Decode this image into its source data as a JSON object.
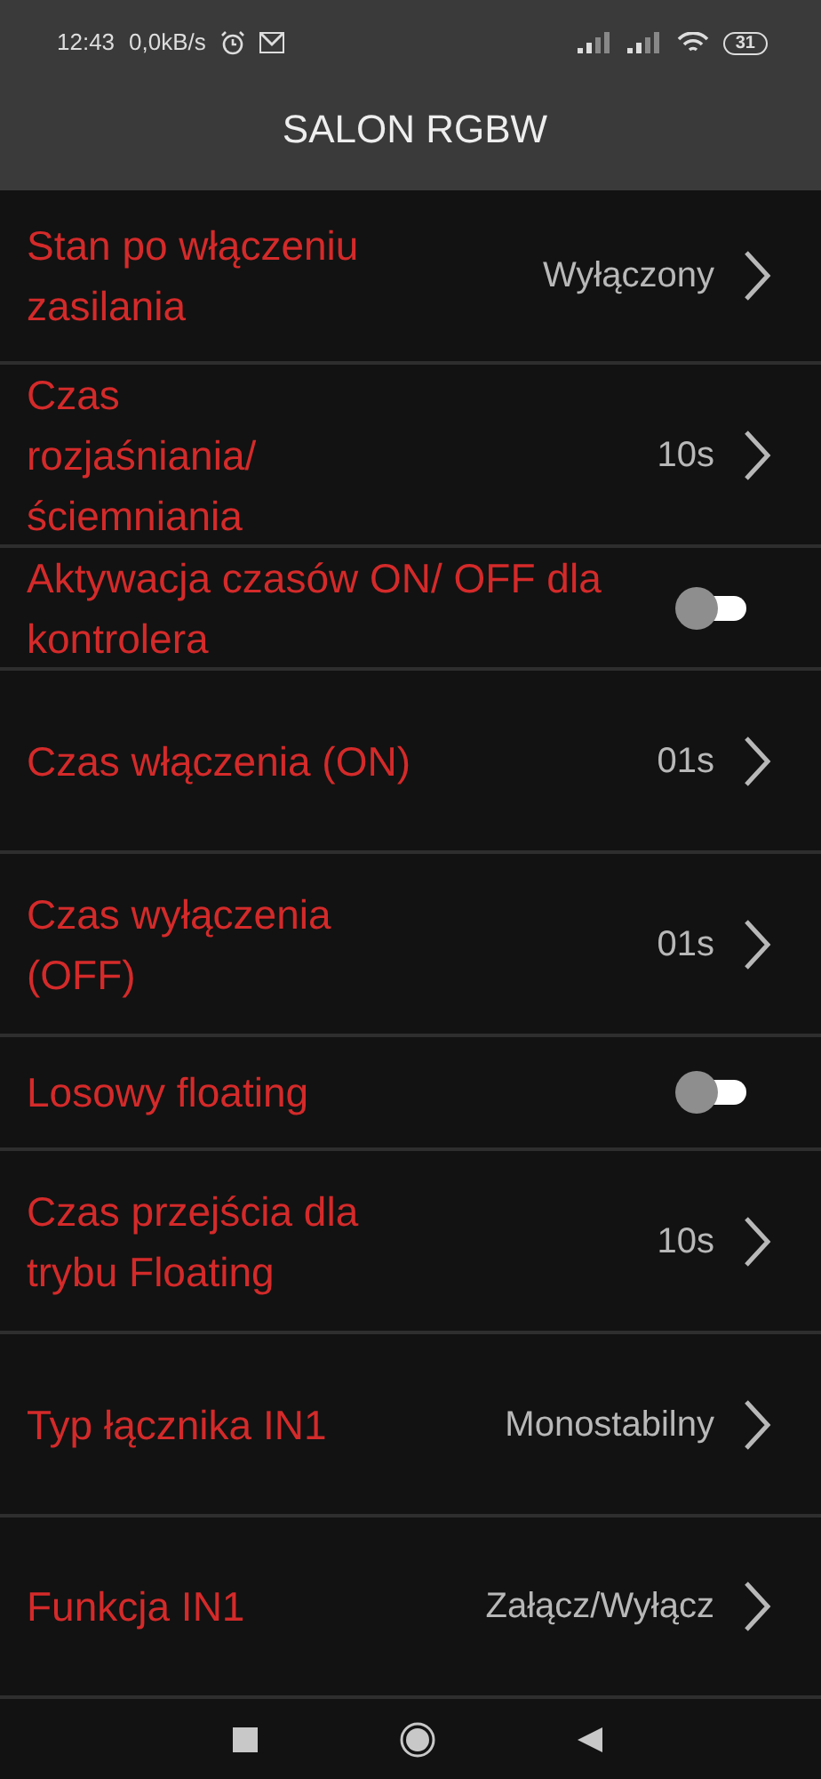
{
  "status_bar": {
    "time": "12:43",
    "speed": "0,0kB/s",
    "battery": "31"
  },
  "header": {
    "title": "SALON RGBW"
  },
  "settings": [
    {
      "kind": "value",
      "label": "Stan po włączeniu zasilania",
      "value": "Wyłączony"
    },
    {
      "kind": "value",
      "label": "Czas rozjaśniania/ ściemniania",
      "value": "10s"
    },
    {
      "kind": "toggle",
      "label": "Aktywacja czasów ON/ OFF dla kontrolera",
      "on": false
    },
    {
      "kind": "value",
      "label": "Czas włączenia (ON)",
      "value": "01s"
    },
    {
      "kind": "value",
      "label": "Czas wyłączenia (OFF)",
      "value": "01s"
    },
    {
      "kind": "toggle",
      "label": "Losowy floating",
      "on": false
    },
    {
      "kind": "value",
      "label": "Czas przejścia dla trybu Floating",
      "value": "10s"
    },
    {
      "kind": "value",
      "label": "Typ łącznika IN1",
      "value": "Monostabilny"
    },
    {
      "kind": "value",
      "label": "Funkcja IN1",
      "value": "Załącz/Wyłącz"
    }
  ]
}
